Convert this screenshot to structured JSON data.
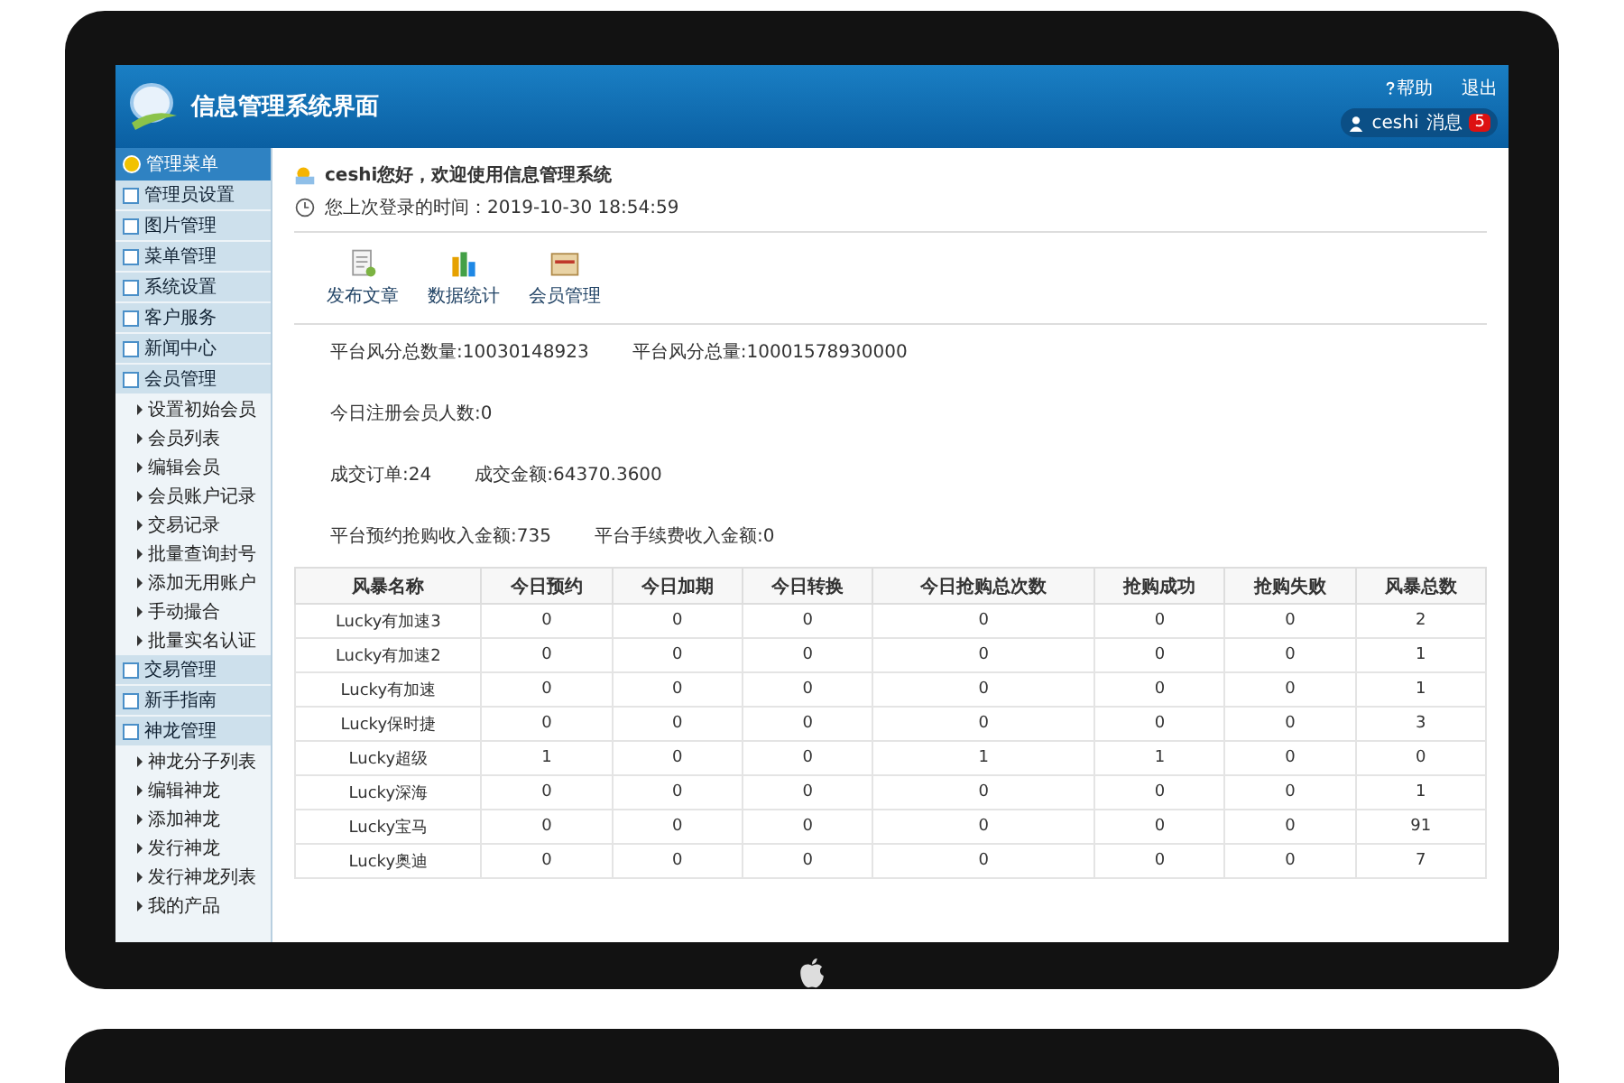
{
  "header": {
    "title": "信息管理系统界面",
    "links": [
      {
        "label": "帮助",
        "kind": "help"
      },
      {
        "label": "退出",
        "kind": "logout"
      }
    ],
    "user": "ceshi",
    "messages_label": "消息",
    "badge": "5"
  },
  "sidebar": {
    "heading": "管理菜单",
    "items": [
      {
        "label": "管理员设置"
      },
      {
        "label": "图片管理"
      },
      {
        "label": "菜单管理"
      },
      {
        "label": "系统设置"
      },
      {
        "label": "客户服务"
      },
      {
        "label": "新闻中心"
      },
      {
        "label": "会员管理",
        "children": [
          {
            "label": "设置初始会员"
          },
          {
            "label": "会员列表"
          },
          {
            "label": "编辑会员"
          },
          {
            "label": "会员账户记录"
          },
          {
            "label": "交易记录"
          },
          {
            "label": "批量查询封号"
          },
          {
            "label": "添加无用账户"
          },
          {
            "label": "手动撮合"
          },
          {
            "label": "批量实名认证"
          }
        ]
      },
      {
        "label": "交易管理"
      },
      {
        "label": "新手指南"
      },
      {
        "label": "神龙管理",
        "children": [
          {
            "label": "神龙分子列表"
          },
          {
            "label": "编辑神龙"
          },
          {
            "label": "添加神龙"
          },
          {
            "label": "发行神龙"
          },
          {
            "label": "发行神龙列表"
          },
          {
            "label": "我的产品"
          }
        ]
      }
    ]
  },
  "welcome": {
    "greeting": "ceshi您好，欢迎使用信息管理系统",
    "last_login": "您上次登录的时间：2019-10-30 18:54:59"
  },
  "shortcuts": [
    {
      "label": "发布文章",
      "kind": "doc"
    },
    {
      "label": "数据统计",
      "kind": "chart"
    },
    {
      "label": "会员管理",
      "kind": "folder"
    }
  ],
  "stats": [
    [
      "平台风分总数量:10030148923",
      "平台风分总量:10001578930000"
    ],
    [
      "今日注册会员人数:0"
    ],
    [
      "成交订单:24",
      "成交金额:64370.3600"
    ],
    [
      "平台预约抢购收入金额:735",
      "平台手续费收入金额:0"
    ]
  ],
  "table": {
    "columns": [
      "风暴名称",
      "今日预约",
      "今日加期",
      "今日转换",
      "今日抢购总次数",
      "抢购成功",
      "抢购失败",
      "风暴总数"
    ],
    "rows": [
      [
        "Lucky有加速3",
        "0",
        "0",
        "0",
        "0",
        "0",
        "0",
        "2"
      ],
      [
        "Lucky有加速2",
        "0",
        "0",
        "0",
        "0",
        "0",
        "0",
        "1"
      ],
      [
        "Lucky有加速",
        "0",
        "0",
        "0",
        "0",
        "0",
        "0",
        "1"
      ],
      [
        "Lucky保时捷",
        "0",
        "0",
        "0",
        "0",
        "0",
        "0",
        "3"
      ],
      [
        "Lucky超级",
        "1",
        "0",
        "0",
        "1",
        "1",
        "0",
        "0"
      ],
      [
        "Lucky深海",
        "0",
        "0",
        "0",
        "0",
        "0",
        "0",
        "1"
      ],
      [
        "Lucky宝马",
        "0",
        "0",
        "0",
        "0",
        "0",
        "0",
        "91"
      ],
      [
        "Lucky奥迪",
        "0",
        "0",
        "0",
        "0",
        "0",
        "0",
        "7"
      ]
    ]
  }
}
